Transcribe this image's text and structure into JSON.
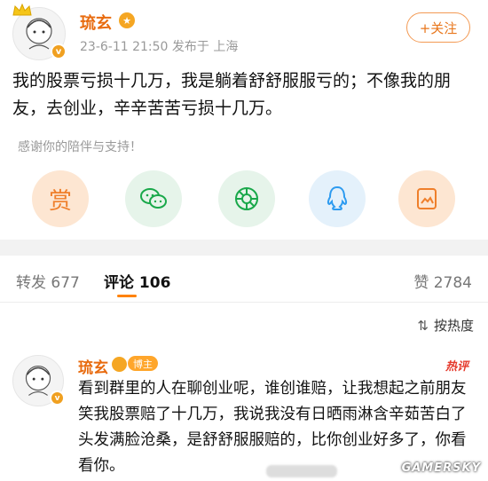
{
  "post": {
    "username": "琉玄",
    "meta": "23-6-11 21:50  发布于 上海",
    "follow_label": "+关注",
    "text": "我的股票亏损十几万，我是躺着舒舒服服亏的；不像我的朋友，去创业，辛辛苦苦亏损十几万。",
    "thanks": "感谢你的陪伴与支持！",
    "reward_label": "赏",
    "verified_badge": "v"
  },
  "tabs": {
    "repost": "转发 677",
    "comment": "评论 106",
    "like": "赞 2784"
  },
  "sort": {
    "label": "按热度"
  },
  "comment": {
    "username": "琉玄",
    "badge": "博主",
    "hot": "热评",
    "verified_badge": "v",
    "text": "看到群里的人在聊创业呢，谁创谁赔，让我想起之前朋友笑我股票赔了十几万，我说我没有日晒雨淋含辛茹苦白了头发满脸沧桑，是舒舒服服赔的，比你创业好多了，你看看你。"
  },
  "watermark": "GAMERSKY",
  "colors": {
    "accent": "#e86b0f",
    "follow_border": "#f39a54",
    "tab_underline": "#ff8200",
    "hot": "#e53a2c"
  },
  "icons": [
    "crown-icon",
    "wechat-icon",
    "moments-icon",
    "qq-icon",
    "save-image-icon",
    "sort-icon"
  ]
}
